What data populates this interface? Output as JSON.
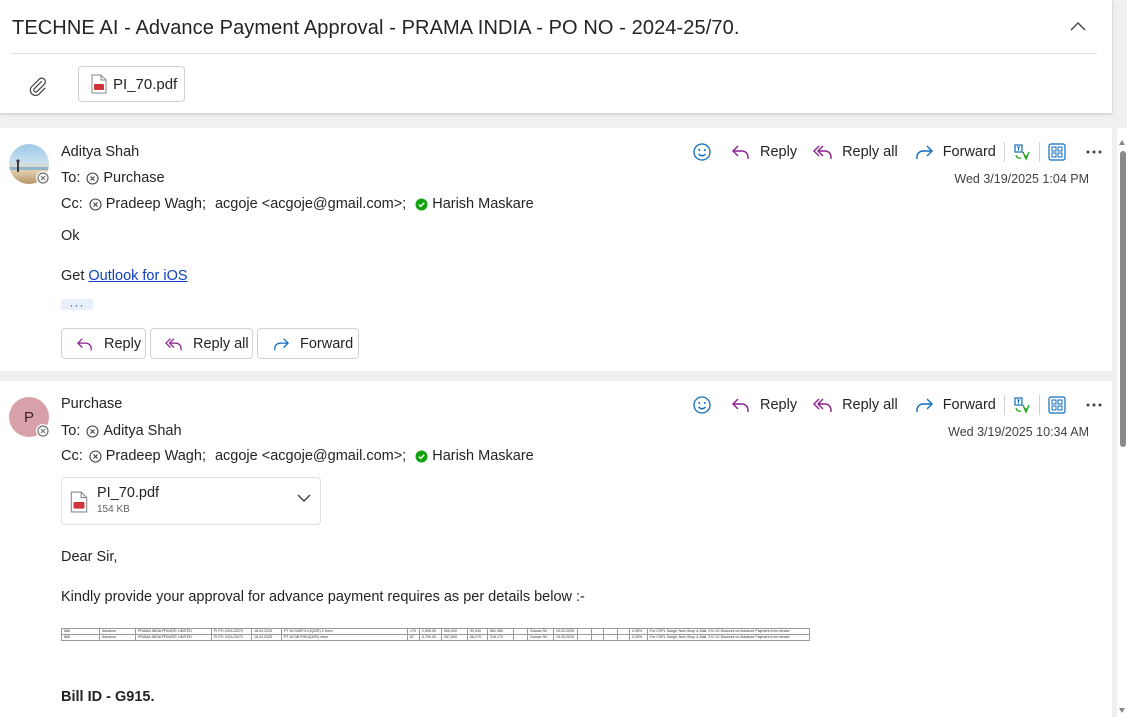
{
  "thread": {
    "subject": "TECHNE AI - Advance Payment Approval - PRAMA INDIA - PO NO - 2024-25/70.",
    "attachment_name": "PI_70.pdf"
  },
  "actions": {
    "reply": "Reply",
    "reply_all": "Reply all",
    "forward": "Forward"
  },
  "message1": {
    "sender": "Aditya Shah",
    "to_label": "To:",
    "to": "Purchase",
    "cc_label": "Cc:",
    "cc": [
      "Pradeep Wagh;",
      "acgoje <acgoje@gmail.com>;",
      "Harish Maskare"
    ],
    "date": "Wed 3/19/2025 1:04 PM",
    "body_line1": "Ok",
    "body_get": "Get",
    "body_link": "Outlook for iOS",
    "more": "···"
  },
  "message2": {
    "sender": "Purchase",
    "avatar_initial": "P",
    "to_label": "To:",
    "to": "Aditya Shah",
    "cc_label": "Cc:",
    "cc": [
      "Pradeep Wagh;",
      "acgoje <acgoje@gmail.com>;",
      "Harish Maskare"
    ],
    "date": "Wed 3/19/2025 10:34 AM",
    "attachment": {
      "name": "PI_70.pdf",
      "size": "154 KB"
    },
    "greeting": "Dear Sir,",
    "intro": "Kindly provide your approval for advance payment requires as per details below :-",
    "table_rows": [
      [
        "866",
        "Advance",
        "PRAMA INDIA PRIVATE LIMITED",
        "PI PO 2024-25/70",
        "18.03.2025",
        "PT NC33DP/13.5(32R) 2.4mm",
        "170",
        "2,890.00",
        "500,000",
        "90,040",
        "581,980",
        "",
        "Gaurav Sir",
        "19.03.2025",
        "",
        "",
        "",
        "",
        "0.05%",
        "For CSPL Sangli, New Shop & Mail. 2% CD Discount on Advance Payment from vendor"
      ],
      [
        "866",
        "Advance",
        "PRAMA INDIA PRIVATE LIMITED",
        "PI PO 2024-25/70",
        "18.03.2025",
        "PT NC3B PH5.6(32R) 4mm",
        "87",
        "4,790.00",
        "267,600",
        "48,270",
        "316,170",
        "",
        "Gaurav Sir",
        "19.03.2025",
        "",
        "",
        "",
        "",
        "0.05%",
        "For CSPL Sangli, New Shop & Mail. 2% CD Discount on Advance Payment from vendor"
      ]
    ],
    "bill": "Bill ID - G915."
  },
  "colors": {
    "accent_purple": "#8b1f8f",
    "accent_blue": "#0f6cbd",
    "link": "#0f3fbf",
    "presence_green": "#13a10e",
    "avatar_purchase": "#d8a0a8"
  }
}
